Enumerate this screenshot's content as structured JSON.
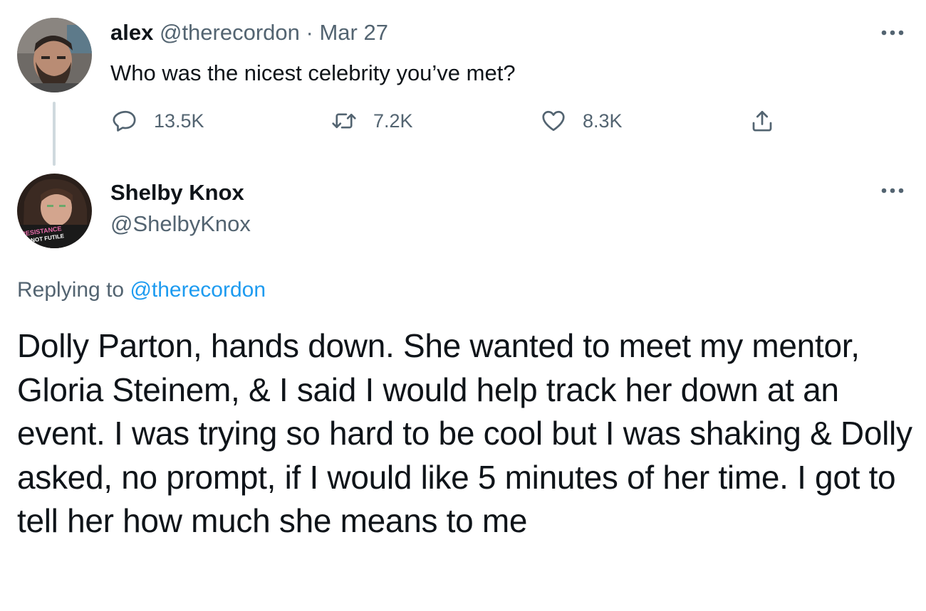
{
  "parent_tweet": {
    "display_name": "alex",
    "handle": "@therecordon",
    "separator": "·",
    "date": "Mar 27",
    "text": "Who was the nicest celebrity you’ve met?",
    "actions": {
      "reply_count": "13.5K",
      "retweet_count": "7.2K",
      "like_count": "8.3K"
    }
  },
  "reply_tweet": {
    "display_name": "Shelby Knox",
    "handle": "@ShelbyKnox",
    "replying_to_prefix": "Replying to",
    "replying_to_handle": "@therecordon",
    "text": "Dolly Parton, hands down. She wanted to meet my mentor, Gloria Steinem, & I said I would help track her down at an event. I was trying so hard to be cool but I was shaking & Dolly asked, no prompt, if I would like 5 minutes of her time. I got to tell her how much she means to me",
    "avatar_shirt_text": "RESISTANCE IS NOT FUTILE"
  },
  "icons": {
    "reply": "speech-bubble-icon",
    "retweet": "retweet-arrows-icon",
    "like": "heart-icon",
    "share": "share-upload-icon",
    "more": "ellipsis-icon"
  },
  "colors": {
    "text_primary": "#0f1419",
    "text_secondary": "#536471",
    "link": "#1d9bf0",
    "thread_line": "#cfd9de"
  }
}
